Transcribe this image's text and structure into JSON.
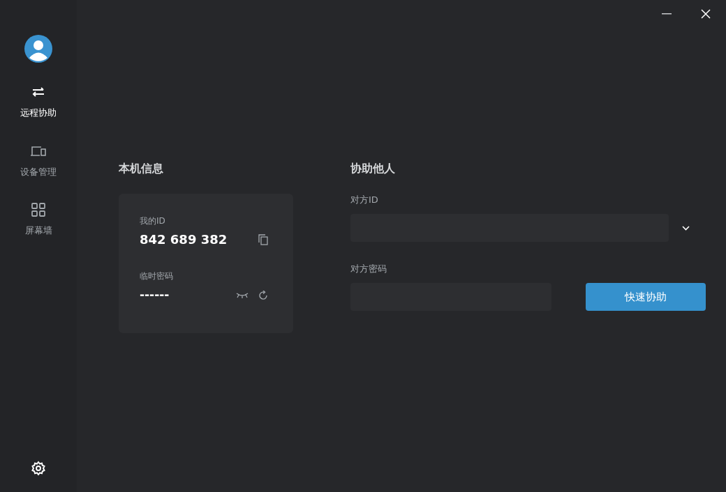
{
  "sidebar": {
    "items": [
      {
        "label": "远程协助",
        "selected": true
      },
      {
        "label": "设备管理",
        "selected": false
      },
      {
        "label": "屏幕墙",
        "selected": false
      }
    ]
  },
  "local_info": {
    "title": "本机信息",
    "my_id_label": "我的ID",
    "my_id": "842 689 382",
    "temp_password_label": "临时密码",
    "temp_password": "------"
  },
  "help_others": {
    "title": "协助他人",
    "peer_id_label": "对方ID",
    "peer_password_label": "对方密码",
    "button": "快速协助"
  }
}
